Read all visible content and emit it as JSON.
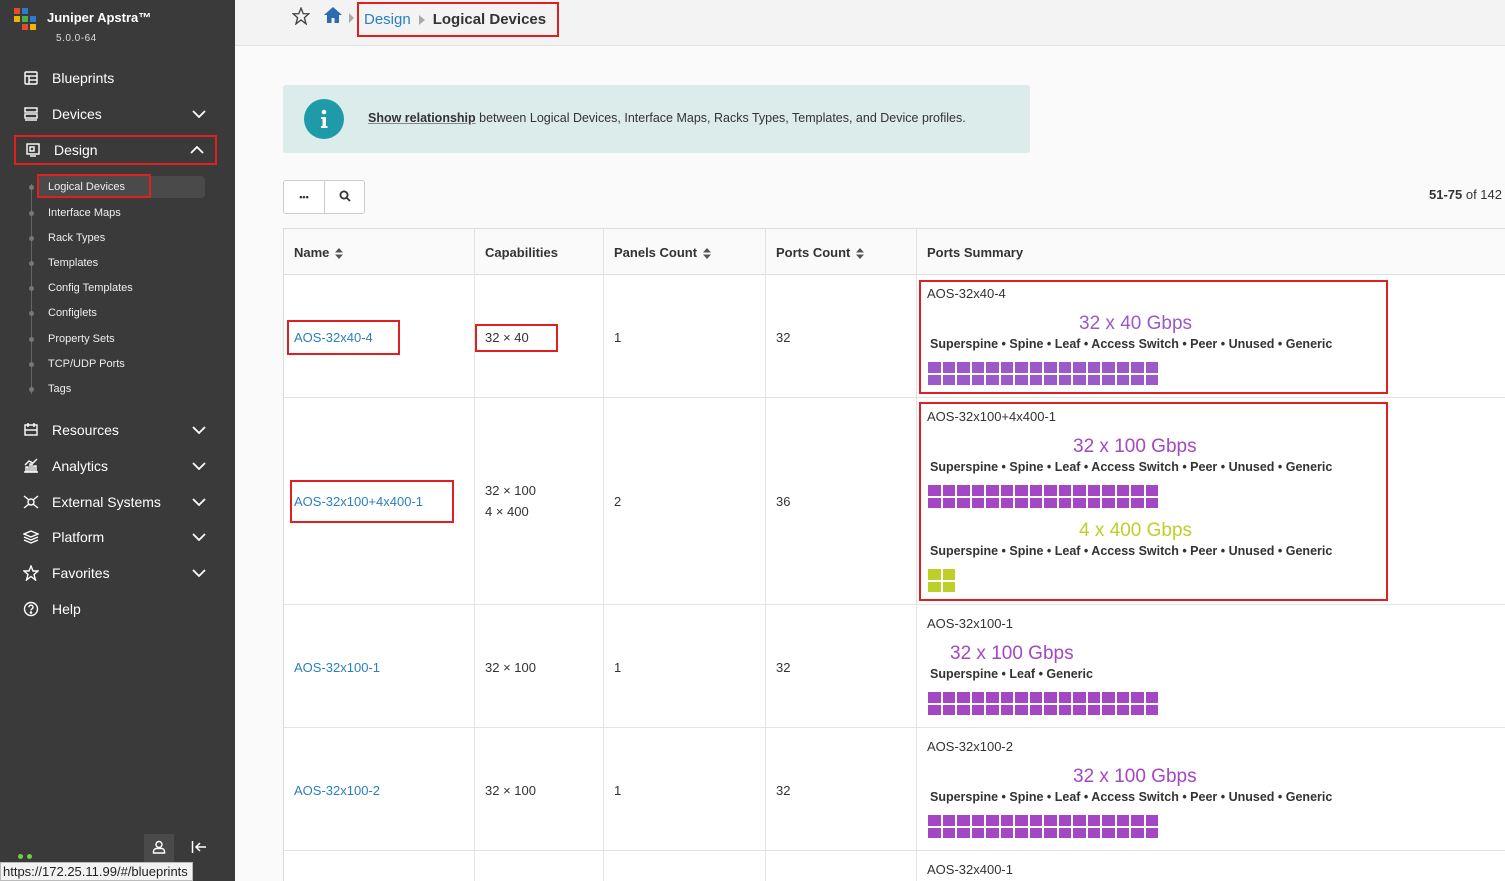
{
  "app": {
    "name": "Juniper Apstra™",
    "version": "5.0.0-64"
  },
  "nav": {
    "blueprints": "Blueprints",
    "devices": "Devices",
    "design": "Design",
    "resources": "Resources",
    "analytics": "Analytics",
    "external_systems": "External Systems",
    "platform": "Platform",
    "favorites": "Favorites",
    "help": "Help"
  },
  "design_sub": [
    "Logical Devices",
    "Interface Maps",
    "Rack Types",
    "Templates",
    "Config Templates",
    "Configlets",
    "Property Sets",
    "TCP/UDP Ports",
    "Tags"
  ],
  "breadcrumb": {
    "parent": "Design",
    "current": "Logical Devices"
  },
  "info": {
    "link": "Show relationship",
    "text": " between Logical Devices, Interface Maps, Racks Types, Templates, and Device profiles."
  },
  "toolbar": {
    "more": "•••"
  },
  "pagination": {
    "range": "51-75",
    "of": " of 142"
  },
  "table": {
    "headers": [
      "Name",
      "Capabilities",
      "Panels Count",
      "Ports Count",
      "Ports Summary"
    ],
    "rows": [
      {
        "name": "AOS-32x40-4",
        "capabilities": [
          "32 × 40"
        ],
        "panels": "1",
        "ports": "32",
        "summary_name": "AOS-32x40-4",
        "groups": [
          {
            "speed": "32 x 40 Gbps",
            "roles": "Superspine • Spine • Leaf • Access Switch • Peer • Unused • Generic",
            "count": 32,
            "color": "#9b59c9"
          }
        ]
      },
      {
        "name": "AOS-32x100+4x400-1",
        "capabilities": [
          "32 × 100",
          "4 × 400"
        ],
        "panels": "2",
        "ports": "36",
        "summary_name": "AOS-32x100+4x400-1",
        "groups": [
          {
            "speed": "32 x 100 Gbps",
            "roles": "Superspine • Spine • Leaf • Access Switch • Peer • Unused • Generic",
            "count": 32,
            "color": "#a447c4"
          },
          {
            "speed": "4 x 400 Gbps",
            "roles": "Superspine • Spine • Leaf • Access Switch • Peer • Unused • Generic",
            "count": 4,
            "color": "#bfcf2a"
          }
        ]
      },
      {
        "name": "AOS-32x100-1",
        "capabilities": [
          "32 × 100"
        ],
        "panels": "1",
        "ports": "32",
        "summary_name": "AOS-32x100-1",
        "groups": [
          {
            "speed": "32 x 100 Gbps",
            "roles": "Superspine • Leaf • Generic",
            "count": 32,
            "color": "#a447c4"
          }
        ]
      },
      {
        "name": "AOS-32x100-2",
        "capabilities": [
          "32 × 100"
        ],
        "panels": "1",
        "ports": "32",
        "summary_name": "AOS-32x100-2",
        "groups": [
          {
            "speed": "32 x 100 Gbps",
            "roles": "Superspine • Spine • Leaf • Access Switch • Peer • Unused • Generic",
            "count": 32,
            "color": "#a447c4"
          }
        ]
      },
      {
        "summary_name": "AOS-32x400-1"
      }
    ]
  },
  "status_url": "https://172.25.11.99/#/blueprints"
}
